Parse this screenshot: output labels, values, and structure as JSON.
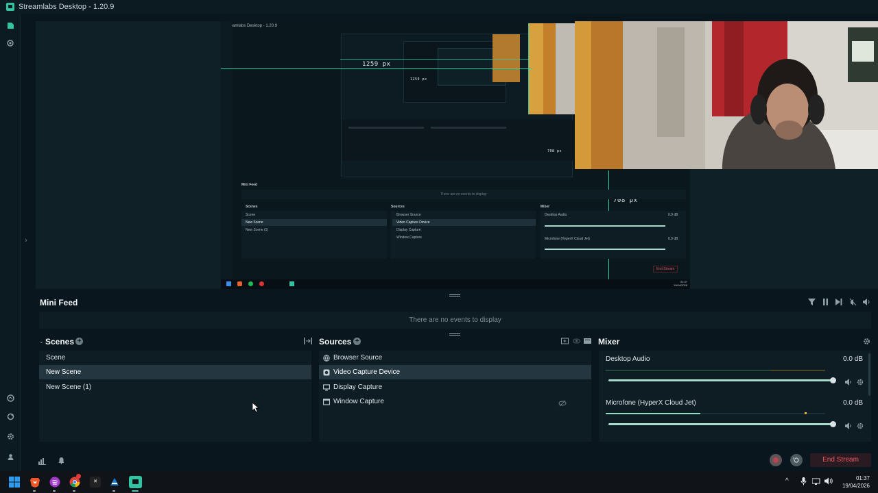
{
  "app": {
    "title": "Streamlabs Desktop - 1.20.9"
  },
  "nav": {
    "top": [
      "editor-icon",
      "record-icon"
    ],
    "bottom": [
      "themes-icon",
      "apps-icon",
      "settings-icon",
      "user-icon"
    ]
  },
  "preview": {
    "nested_title": "Streamlabs Desktop - 1.20.9",
    "width_label": "1259 px",
    "height_label": "708 px",
    "nested_small_px_1": "1259 px",
    "nested_small_px_2": "708 px",
    "nested_feed_title": "Mini Feed",
    "nested_feed_empty": "There are no events to display",
    "nested_scenes_title": "Scenes",
    "nested_sources_title": "Sources",
    "nested_mixer_title": "Mixer",
    "nested_scenes": [
      "Scene",
      "New Scene",
      "New Scene (1)"
    ],
    "nested_sources": [
      "Browser Source",
      "Video Capture Device",
      "Display Capture",
      "Window Capture"
    ],
    "nested_mixer": [
      {
        "name": "Desktop Audio",
        "db": "0.0 dB"
      },
      {
        "name": "Microfone (HyperX Cloud Jet)",
        "db": "0.0 dB"
      }
    ],
    "nested_end_stream": "End Stream",
    "nested_clock_time": "01:37",
    "nested_clock_date": "19/04/2026"
  },
  "mini_feed": {
    "title": "Mini Feed",
    "empty_text": "There are no events to display",
    "controls": [
      "filter-icon",
      "pause-icon",
      "skip-icon",
      "mute-feed-icon",
      "volume-icon"
    ]
  },
  "scenes": {
    "title": "Scenes",
    "items": [
      {
        "label": "Scene",
        "selected": false
      },
      {
        "label": "New Scene",
        "selected": true
      },
      {
        "label": "New Scene (1)",
        "selected": false
      }
    ]
  },
  "sources": {
    "title": "Sources",
    "items": [
      {
        "label": "Browser Source",
        "icon": "globe-icon",
        "selected": false
      },
      {
        "label": "Video Capture Device",
        "icon": "camera-icon",
        "selected": true
      },
      {
        "label": "Display Capture",
        "icon": "monitor-icon",
        "selected": false
      },
      {
        "label": "Window Capture",
        "icon": "window-icon",
        "selected": false
      }
    ]
  },
  "mixer": {
    "title": "Mixer",
    "items": [
      {
        "name": "Desktop Audio",
        "db": "0.0 dB",
        "volume": 1.0
      },
      {
        "name": "Microfone (HyperX Cloud Jet)",
        "db": "0.0 dB",
        "volume": 1.0
      }
    ]
  },
  "footer": {
    "end_stream": "End Stream"
  },
  "taskbar": {
    "apps": [
      "windows-start-icon",
      "brave-icon",
      "spotify-icon",
      "chrome-icon",
      "epic-icon",
      "steam-icon",
      "streamlabs-icon"
    ],
    "clock_time": "01:37",
    "clock_date": "19/04/2026"
  },
  "colors": {
    "accent": "#31c3a2",
    "end_stream": "#ef5a65",
    "background": "#09161d",
    "panel": "#0e1c23"
  }
}
